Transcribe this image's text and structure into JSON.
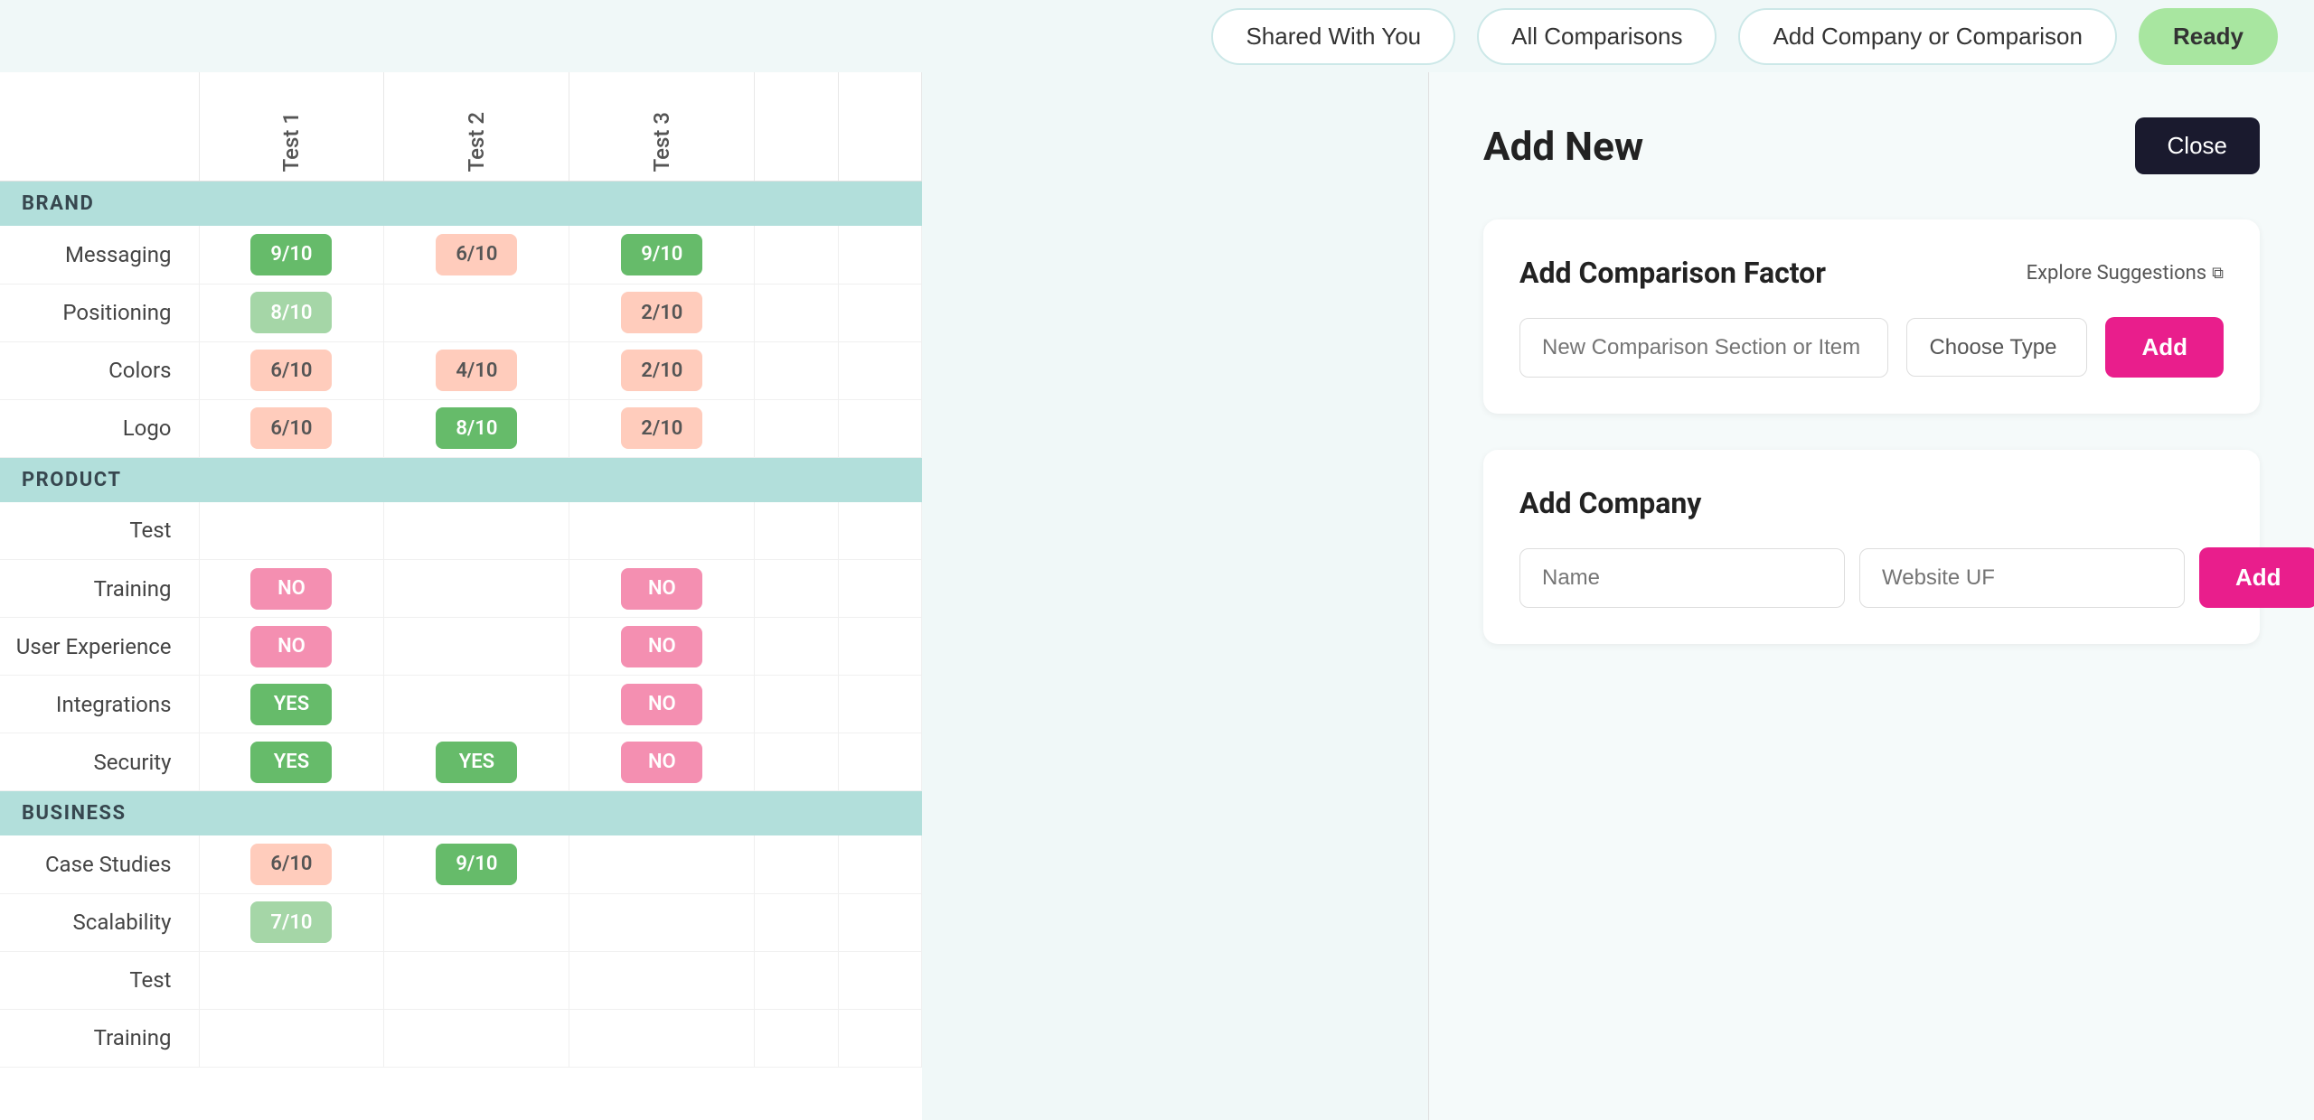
{
  "nav": {
    "shared_with_you": "Shared With You",
    "all_comparisons": "All Comparisons",
    "add_company": "Add Company or Comparison",
    "ready": "Ready"
  },
  "table": {
    "columns": [
      "Test 1",
      "Test 2",
      "Test 3",
      "",
      ""
    ],
    "sections": [
      {
        "label": "BRAND",
        "rows": [
          {
            "label": "Messaging",
            "values": [
              "9/10",
              "6/10",
              "9/10",
              "",
              ""
            ]
          },
          {
            "label": "Positioning",
            "values": [
              "8/10",
              "",
              "2/10",
              "",
              ""
            ]
          },
          {
            "label": "Colors",
            "values": [
              "6/10",
              "4/10",
              "2/10",
              "",
              ""
            ]
          },
          {
            "label": "Logo",
            "values": [
              "6/10",
              "8/10",
              "2/10",
              "",
              ""
            ]
          }
        ]
      },
      {
        "label": "PRODUCT",
        "rows": [
          {
            "label": "Test",
            "values": [
              "",
              "",
              "",
              "",
              ""
            ]
          },
          {
            "label": "Training",
            "values": [
              "NO",
              "",
              "NO",
              "",
              ""
            ]
          },
          {
            "label": "User Experience",
            "values": [
              "NO",
              "",
              "NO",
              "",
              ""
            ]
          },
          {
            "label": "Integrations",
            "values": [
              "YES",
              "",
              "NO",
              "",
              ""
            ]
          },
          {
            "label": "Security",
            "values": [
              "YES",
              "YES",
              "NO",
              "",
              ""
            ]
          }
        ]
      },
      {
        "label": "BUSINESS",
        "rows": [
          {
            "label": "Case Studies",
            "values": [
              "6/10",
              "9/10",
              "",
              "",
              ""
            ]
          },
          {
            "label": "Scalability",
            "values": [
              "7/10",
              "",
              "",
              "",
              ""
            ]
          },
          {
            "label": "Test",
            "values": [
              "",
              "",
              "",
              "",
              ""
            ]
          },
          {
            "label": "Training",
            "values": [
              "",
              "",
              "",
              "",
              ""
            ]
          }
        ]
      }
    ]
  },
  "panel": {
    "title": "Add New",
    "close_label": "Close",
    "comparison_factor": {
      "title": "Add Comparison Factor",
      "explore_label": "Explore Suggestions",
      "input_placeholder": "New Comparison Section or Item",
      "type_label": "Choose Type",
      "add_label": "Add"
    },
    "add_company": {
      "title": "Add Company",
      "name_placeholder": "Name",
      "website_placeholder": "Website UF",
      "add_label": "Add"
    }
  },
  "cell_colors": {
    "9/10_c1": "green",
    "6/10_c1": "peach",
    "8/10_c1": "green",
    "6/10_c2": "peach",
    "4/10_c2": "peach",
    "8/10_c2": "green",
    "9/10_c3": "green",
    "2/10_c3": "peach",
    "YES_green": "green",
    "NO_pink": "pink",
    "7/10_green": "light-green"
  }
}
